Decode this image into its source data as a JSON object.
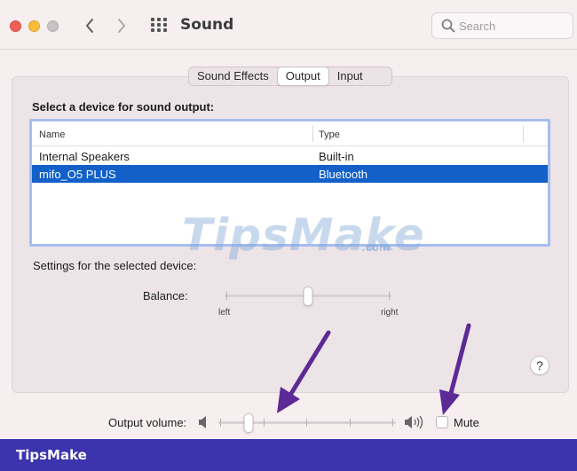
{
  "window": {
    "title": "Sound",
    "search_placeholder": "Search"
  },
  "tabs": [
    {
      "label": "Sound Effects",
      "active": false
    },
    {
      "label": "Output",
      "active": true
    },
    {
      "label": "Input",
      "active": false
    }
  ],
  "output": {
    "heading": "Select a device for sound output:",
    "columns": {
      "name": "Name",
      "type": "Type"
    },
    "devices": [
      {
        "name": "Internal Speakers",
        "type": "Built-in",
        "selected": false
      },
      {
        "name": "mifo_O5 PLUS",
        "type": "Bluetooth",
        "selected": true
      }
    ],
    "settings_label": "Settings for the selected device:",
    "balance": {
      "label": "Balance:",
      "left_label": "left",
      "right_label": "right",
      "value": 0.5
    },
    "help_label": "?",
    "volume": {
      "label": "Output volume:",
      "value": 0.17
    },
    "mute": {
      "label": "Mute",
      "checked": false
    }
  },
  "watermark": {
    "text": "TipsMake",
    "suffix": ".com"
  },
  "footer": {
    "brand": "TipsMake"
  },
  "colors": {
    "selection": "#1260c8",
    "table_focus": "#a7bdf0",
    "annotation_arrow": "#5b2a96",
    "footer_bg": "#3b34ad"
  }
}
